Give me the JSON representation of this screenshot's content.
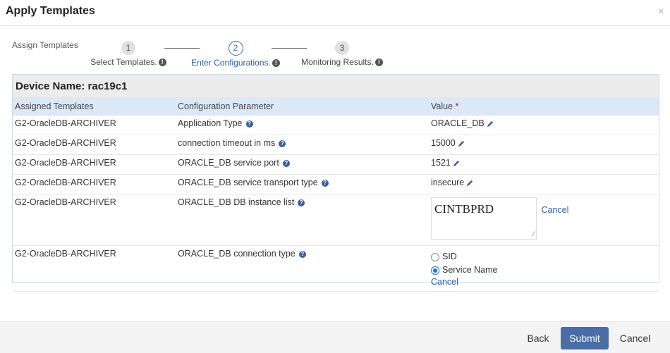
{
  "dialog": {
    "title": "Apply Templates",
    "close_glyph": "×"
  },
  "wizard": {
    "label": "Assign Templates",
    "steps": [
      {
        "num": "1",
        "label": "Select Templates."
      },
      {
        "num": "2",
        "label": "Enter Configurations."
      },
      {
        "num": "3",
        "label": "Monitoring Results."
      }
    ],
    "info_glyph": "!"
  },
  "device": {
    "label": "Device Name: rac19c1"
  },
  "table": {
    "headers": [
      "Assigned Templates",
      "Configuration Parameter",
      "Value"
    ],
    "required_mark": "*",
    "rows": [
      {
        "template": "G2-OracleDB-ARCHIVER",
        "param": "Application Type",
        "value": "ORACLE_DB"
      },
      {
        "template": "G2-OracleDB-ARCHIVER",
        "param": "connection timeout in ms",
        "value": "15000"
      },
      {
        "template": "G2-OracleDB-ARCHIVER",
        "param": "ORACLE_DB service port",
        "value": "1521"
      },
      {
        "template": "G2-OracleDB-ARCHIVER",
        "param": "ORACLE_DB service transport type",
        "value": "insecure"
      },
      {
        "template": "G2-OracleDB-ARCHIVER",
        "param": "ORACLE_DB DB instance list",
        "value": "CINTBPRD",
        "cancel": "Cancel"
      },
      {
        "template": "G2-OracleDB-ARCHIVER",
        "param": "ORACLE_DB connection type",
        "options": [
          "SID",
          "Service Name"
        ],
        "selected": "Service Name",
        "cancel": "Cancel"
      }
    ]
  },
  "footer": {
    "back": "Back",
    "submit": "Submit",
    "cancel": "Cancel"
  },
  "colors": {
    "accent": "#4a6da8",
    "link": "#2a5ea8",
    "header_bg": "#dce8f5"
  }
}
